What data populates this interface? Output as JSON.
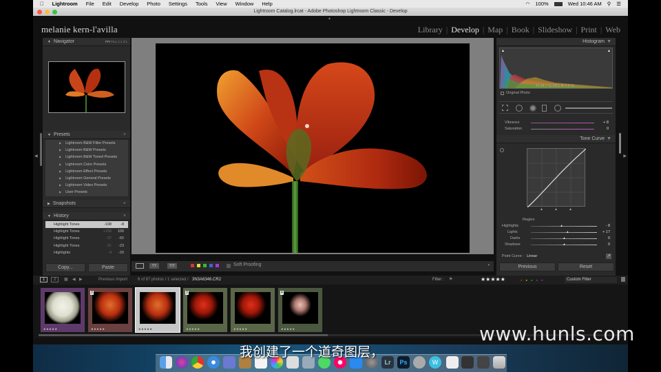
{
  "menubar": {
    "apple": "",
    "app_name": "Lightroom",
    "items": [
      "File",
      "Edit",
      "Develop",
      "Photo",
      "Settings",
      "Tools",
      "View",
      "Window",
      "Help"
    ],
    "battery": "100%",
    "clock": "Wed 10:46 AM"
  },
  "window": {
    "title": "Lightroom Catalog.lrcat - Adobe Photoshop Lightroom Classic - Develop"
  },
  "identity_plate": "melanie kern-l'avilla",
  "modules": [
    {
      "label": "Library",
      "active": false
    },
    {
      "label": "Develop",
      "active": true
    },
    {
      "label": "Map",
      "active": false
    },
    {
      "label": "Book",
      "active": false
    },
    {
      "label": "Slideshow",
      "active": false
    },
    {
      "label": "Print",
      "active": false
    },
    {
      "label": "Web",
      "active": false
    }
  ],
  "left_panel": {
    "navigator": {
      "title": "Navigator",
      "zoom_options": [
        "FIT",
        "FILL",
        "1:1",
        "3:1"
      ]
    },
    "presets": {
      "title": "Presets",
      "items": [
        "Lightroom B&W Filter Presets",
        "Lightroom B&W Presets",
        "Lightroom B&W Toned Presets",
        "Lightroom Color Presets",
        "Lightroom Effect Presets",
        "Lightroom General Presets",
        "Lightroom Video Presets",
        "User Presets"
      ]
    },
    "snapshots": {
      "title": "Snapshots"
    },
    "history": {
      "title": "History",
      "items": [
        {
          "label": "Highlight Tones",
          "v1": "-108",
          "v2": "-8",
          "selected": true
        },
        {
          "label": "Highlight Tones",
          "v1": "+158",
          "v2": "100",
          "selected": false
        },
        {
          "label": "Highlight Tones",
          "v1": "-37",
          "v2": "-50",
          "selected": false
        },
        {
          "label": "Highlight Tones",
          "v1": "-31",
          "v2": "-23",
          "selected": false
        },
        {
          "label": "Highlights",
          "v1": "-4",
          "v2": "-20",
          "selected": false
        }
      ]
    },
    "copy_label": "Copy...",
    "paste_label": "Paste"
  },
  "toolbar": {
    "soft_proofing": "Soft Proofing"
  },
  "right_panel": {
    "histogram": {
      "title": "Histogram",
      "readout": "R  34.7  G  29.1  B  7.6 %",
      "original_photo": "Original Photo"
    },
    "basic": {
      "vibrance_label": "Vibrance",
      "vibrance_value": "+ 8",
      "saturation_label": "Saturation",
      "saturation_value": "0"
    },
    "tone_curve": {
      "title": "Tone Curve",
      "region_label": "Region",
      "sliders": [
        {
          "label": "Highlights",
          "value": "- 8",
          "pos": 0.46
        },
        {
          "label": "Lights",
          "value": "+ 17",
          "pos": 0.55
        },
        {
          "label": "Darks",
          "value": "0",
          "pos": 0.5
        },
        {
          "label": "Shadows",
          "value": "0",
          "pos": 0.5
        }
      ],
      "point_curve_label": "Point Curve :",
      "point_curve_value": "Linear"
    },
    "previous_label": "Previous",
    "reset_label": "Reset"
  },
  "filmstrip_bar": {
    "page1": "1",
    "page2": "2",
    "source": "Previous Import",
    "count": "6 of 87 photos / 1 selected /",
    "filename": "3N3A6346.CR2",
    "filter_label": "Filter :",
    "stars": "★★★★★",
    "custom_filter": "Custom Filter"
  },
  "filmstrip": [
    {
      "badge": "",
      "stars": "★★★★★",
      "color": "#6a3e74",
      "kind": "rose"
    },
    {
      "badge": "3",
      "stars": "★★★★★",
      "color": "#7a4a4a",
      "kind": "tulip"
    },
    {
      "badge": "",
      "stars": "★★★★★",
      "color": "#c7c7c7",
      "kind": "tulip"
    },
    {
      "badge": "3",
      "stars": "★★★★★",
      "color": "#5d6a4e",
      "kind": "gerbera"
    },
    {
      "badge": "",
      "stars": "★★★★★",
      "color": "#5d6a4e",
      "kind": "gerbera"
    },
    {
      "badge": "4",
      "stars": "★★★★★",
      "color": "#4a5a3e",
      "kind": "bud"
    }
  ],
  "subtitle": "我创建了一个道奇图层，",
  "watermark": "www.hunls.com",
  "dock": {
    "icons": [
      "finder",
      "siri",
      "chrome",
      "safari",
      "launchpad",
      "notes",
      "photos",
      "calculator",
      "preview",
      "messages",
      "music",
      "appstore",
      "settings",
      "lightroom",
      "photoshop",
      "rocket",
      "web",
      "doc",
      "trash"
    ]
  }
}
